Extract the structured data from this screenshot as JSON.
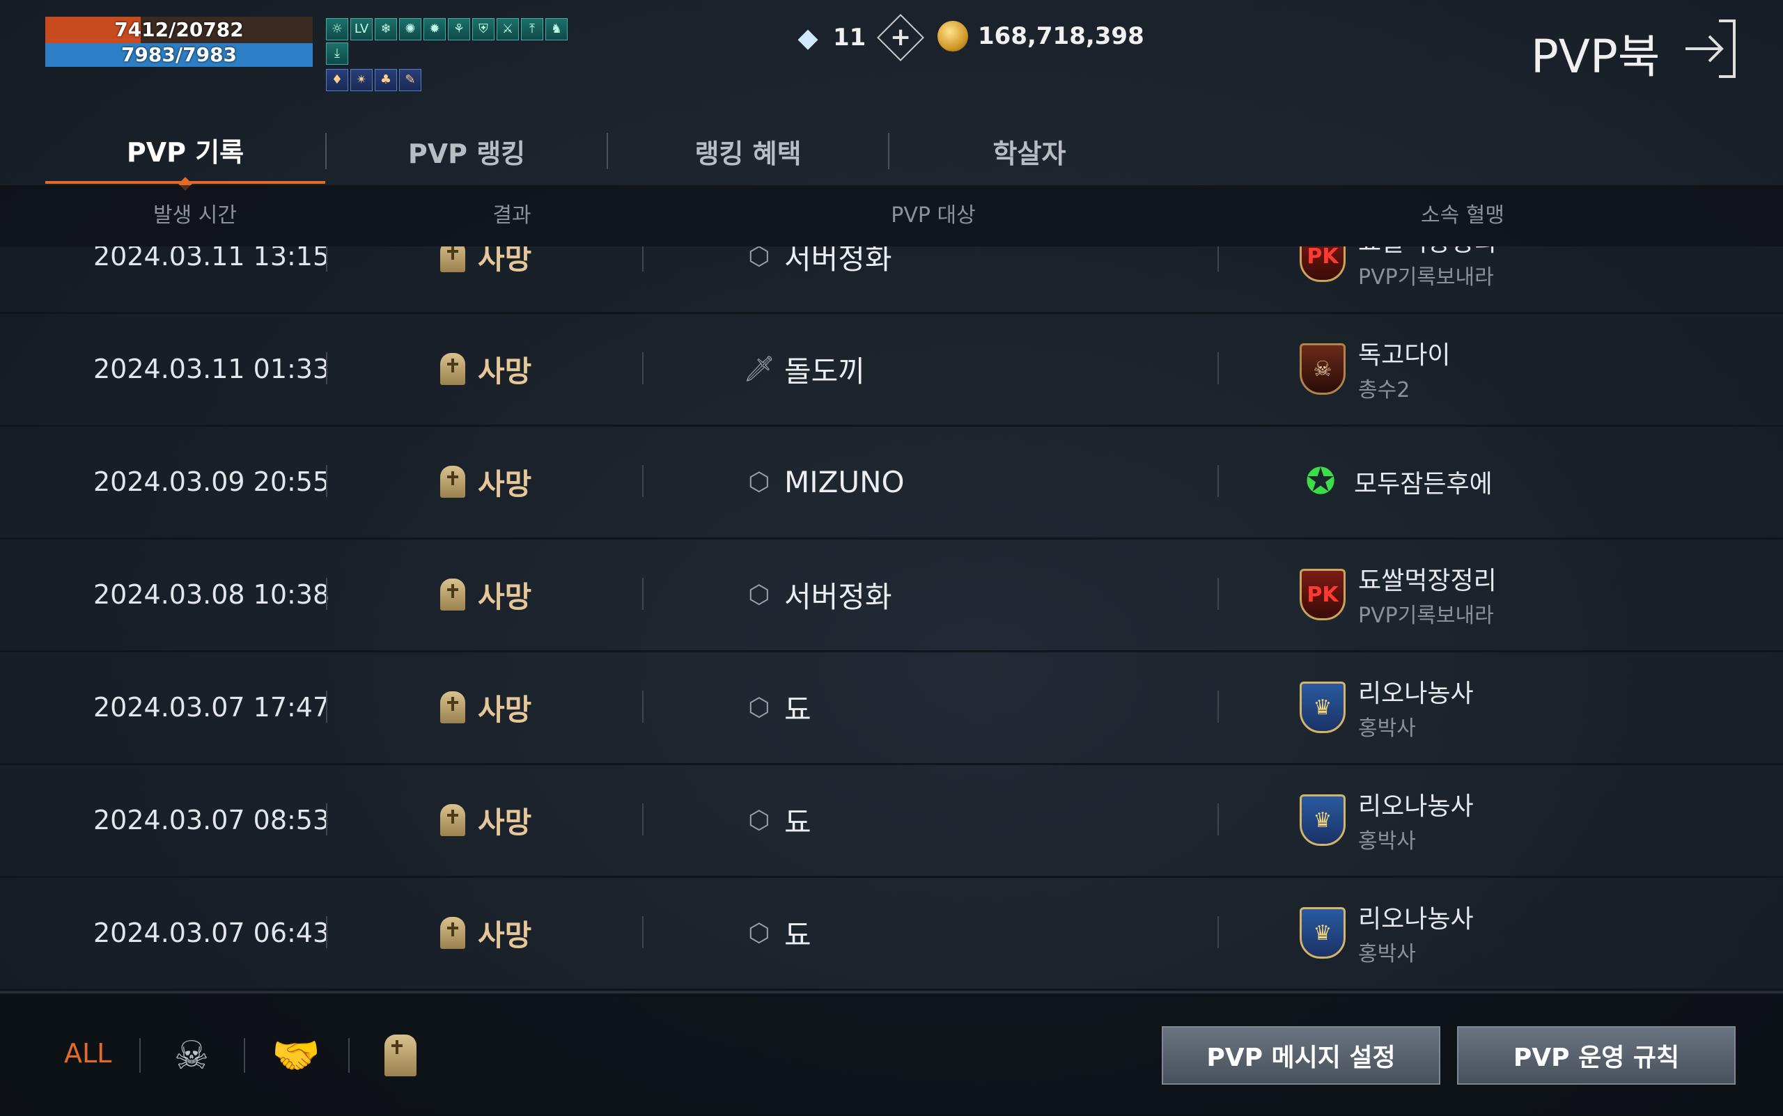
{
  "status": {
    "hp_text": "7412/20782",
    "hp_fraction": 0.357,
    "mp_text": "7983/7983",
    "mp_fraction": 1.0,
    "buff_icons_row1": [
      "☼",
      "LV",
      "❄",
      "✺",
      "✹",
      "⚘",
      "⛨",
      "⚔",
      "⤒",
      "♞",
      "⤓"
    ],
    "buff_icons_row2": [
      "♦",
      "✴",
      "♣",
      "✎"
    ]
  },
  "currency": {
    "gems": "11",
    "gem_icon": "diamond-icon",
    "gold": "168,718,398",
    "gold_icon": "coin-icon"
  },
  "header": {
    "title": "PVP북"
  },
  "tabs": [
    {
      "label": "PVP 기록",
      "active": true
    },
    {
      "label": "PVP 랭킹",
      "active": false
    },
    {
      "label": "랭킹 혜택",
      "active": false
    },
    {
      "label": "학살자",
      "active": false
    }
  ],
  "columns": {
    "time": "발생 시간",
    "result": "결과",
    "target": "PVP 대상",
    "clan": "소속 혈맹"
  },
  "rows": [
    {
      "time": "2024.03.11 13:15",
      "result": "사망",
      "target_icon": "class-crystal-icon",
      "target": "서버정화",
      "clan_crest": "pk",
      "clan": "됴쌀먹장정리",
      "clan_sub": "PVP기록보내라"
    },
    {
      "time": "2024.03.11 01:33",
      "result": "사망",
      "target_icon": "class-dagger-icon",
      "target": "돌도끼",
      "clan_crest": "skull",
      "clan": "독고다이",
      "clan_sub": "총수2"
    },
    {
      "time": "2024.03.09 20:55",
      "result": "사망",
      "target_icon": "class-crystal-icon",
      "target": "MIZUNO",
      "clan_crest": "green",
      "clan": "모두잠든후에",
      "clan_sub": ""
    },
    {
      "time": "2024.03.08 10:38",
      "result": "사망",
      "target_icon": "class-crystal-icon",
      "target": "서버정화",
      "clan_crest": "pk",
      "clan": "됴쌀먹장정리",
      "clan_sub": "PVP기록보내라"
    },
    {
      "time": "2024.03.07 17:47",
      "result": "사망",
      "target_icon": "class-crystal-icon",
      "target": "됴",
      "clan_crest": "royal",
      "clan": "리오나농사",
      "clan_sub": "홍박사"
    },
    {
      "time": "2024.03.07 08:53",
      "result": "사망",
      "target_icon": "class-crystal-icon",
      "target": "됴",
      "clan_crest": "royal",
      "clan": "리오나농사",
      "clan_sub": "홍박사"
    },
    {
      "time": "2024.03.07 06:43",
      "result": "사망",
      "target_icon": "class-crystal-icon",
      "target": "됴",
      "clan_crest": "royal",
      "clan": "리오나농사",
      "clan_sub": "홍박사"
    }
  ],
  "footer": {
    "filter_all": "ALL",
    "filter_icons": [
      "skull-icon",
      "handshake-icon",
      "tombstone-icon"
    ],
    "message_button": "PVP 메시지 설정",
    "rules_button": "PVP 운영 규칙"
  },
  "colors": {
    "accent": "#e46a2a",
    "hp": "#c84b1f",
    "mp": "#2d7fc5",
    "result_text": "#e6c79a"
  }
}
